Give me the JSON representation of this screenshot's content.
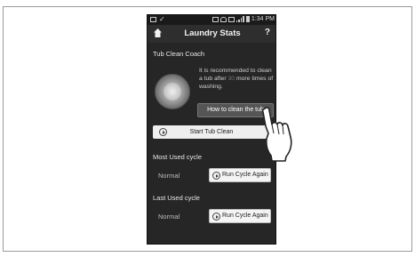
{
  "status_bar": {
    "time": "1:34 PM"
  },
  "header": {
    "title": "Laundry Stats",
    "help_label": "?"
  },
  "coach": {
    "heading": "Tub Clean Coach",
    "advice_pre": "It is recommended to clean a tub after ",
    "advice_count": "30",
    "advice_post": " more times of washing.",
    "how_button": "How to clean the tub",
    "start_button": "Start Tub Clean"
  },
  "most_used": {
    "heading": "Most Used cycle",
    "cycle": "Normal",
    "run_button": "Run Cycle Again"
  },
  "last_used": {
    "heading": "Last Used cycle",
    "cycle": "Normal",
    "run_button": "Run Cycle Again"
  }
}
